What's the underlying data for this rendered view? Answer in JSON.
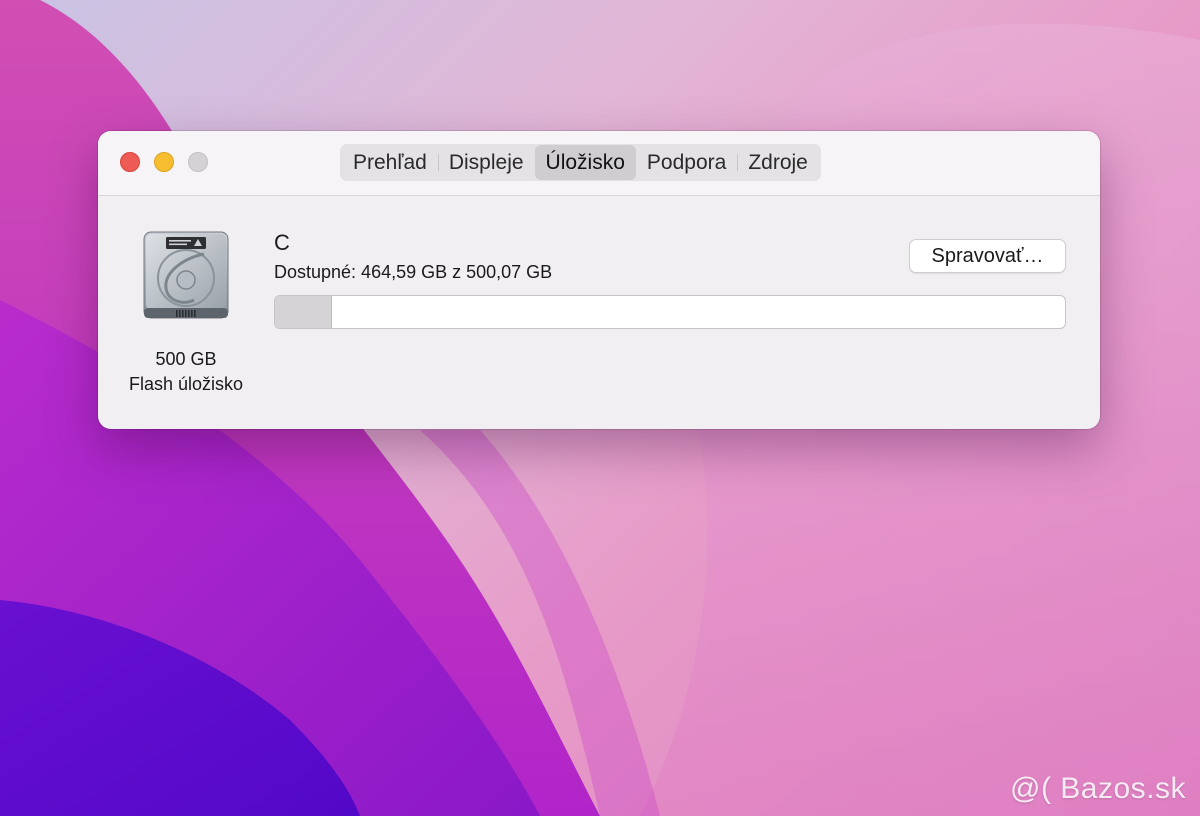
{
  "window": {
    "tabs": [
      {
        "label": "Prehľad"
      },
      {
        "label": "Displeje"
      },
      {
        "label": "Úložisko"
      },
      {
        "label": "Podpora"
      },
      {
        "label": "Zdroje"
      }
    ],
    "active_tab": "Úložisko"
  },
  "storage": {
    "disk_icon": "hard-drive-icon",
    "disk_capacity": "500 GB",
    "disk_type": "Flash úložisko",
    "volume_name": "C",
    "available_text": "Dostupné: 464,59 GB z 500,07 GB",
    "manage_label": "Spravovať…",
    "used_fraction": 0.0709
  },
  "watermark": "@( Bazos.sk",
  "colors": {
    "close": "#ee5b54",
    "minimize": "#f6bd30",
    "zoom": "#d4d2d4",
    "usage_fill": "#d5d3d6"
  }
}
